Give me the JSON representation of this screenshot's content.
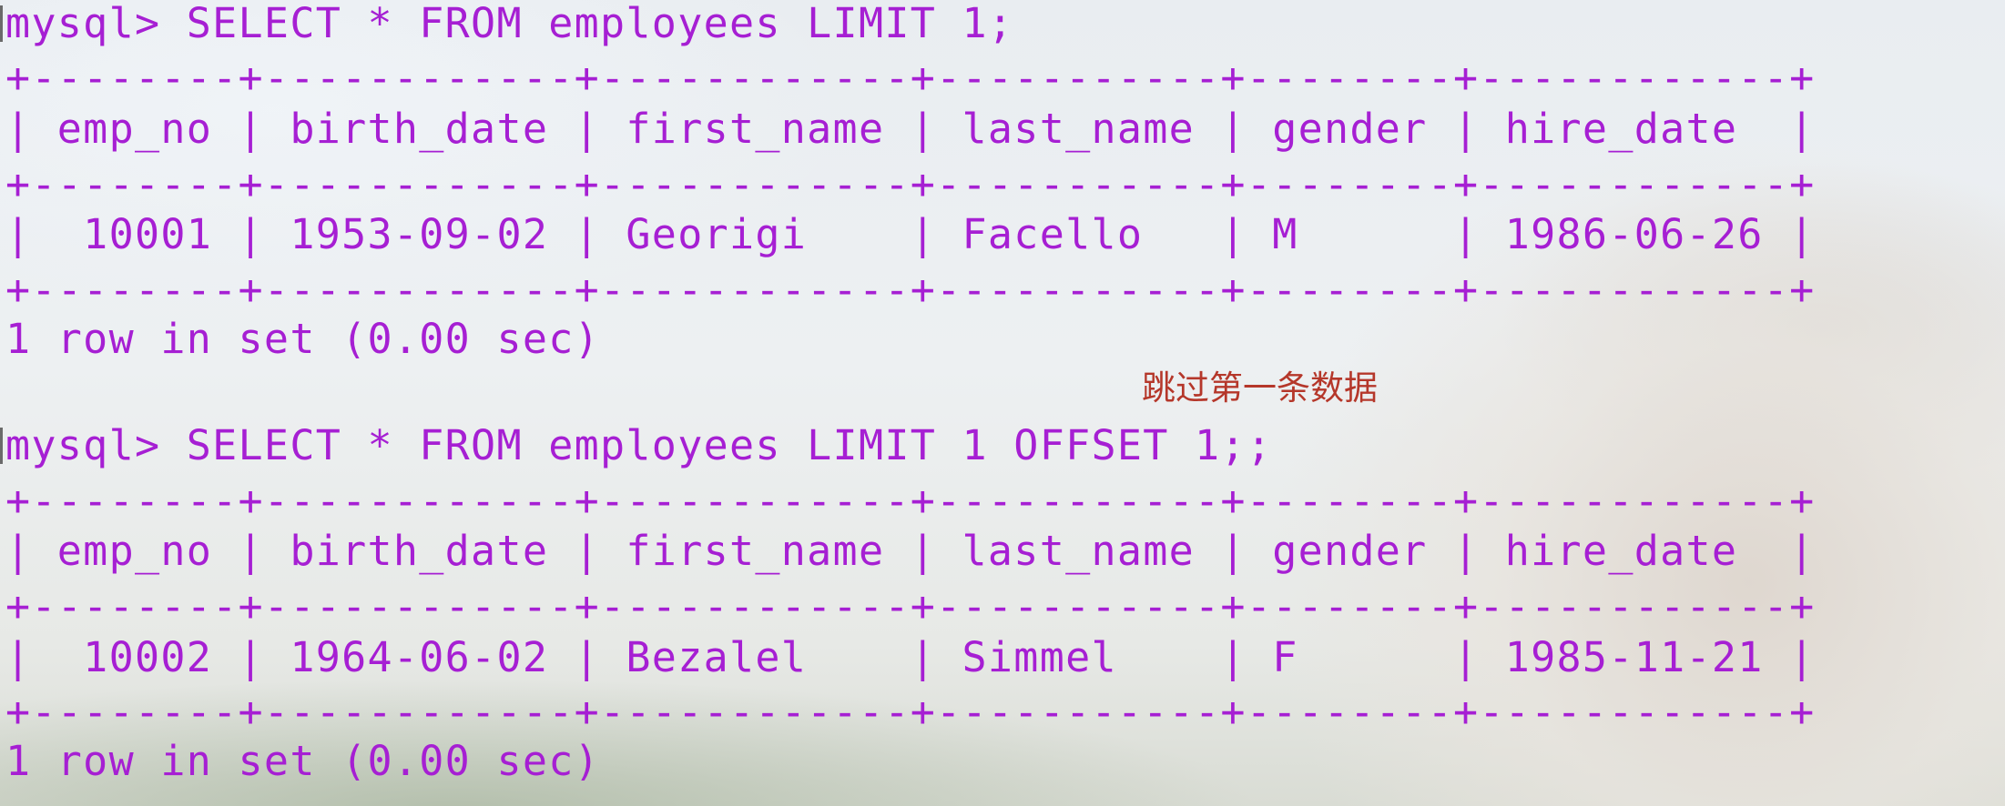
{
  "terminal": {
    "query1": {
      "command": "mysql> SELECT * FROM employees LIMIT 1;",
      "border_top": "+--------+------------+------------+-----------+--------+------------+",
      "header": "| emp_no | birth_date | first_name | last_name | gender | hire_date  |",
      "border_mid": "+--------+------------+------------+-----------+--------+------------+",
      "row": "|  10001 | 1953-09-02 | Georigi    | Facello   | M      | 1986-06-26 |",
      "border_bottom": "+--------+------------+------------+-----------+--------+------------+",
      "result": "1 row in set (0.00 sec)",
      "columns": [
        "emp_no",
        "birth_date",
        "first_name",
        "last_name",
        "gender",
        "hire_date"
      ],
      "rows": [
        [
          "10001",
          "1953-09-02",
          "Georigi",
          "Facello",
          "M",
          "1986-06-26"
        ]
      ]
    },
    "annotation": "跳过第一条数据",
    "query2": {
      "command": "mysql> SELECT * FROM employees LIMIT 1 OFFSET 1;;",
      "border_top": "+--------+------------+------------+-----------+--------+------------+",
      "header": "| emp_no | birth_date | first_name | last_name | gender | hire_date  |",
      "border_mid": "+--------+------------+------------+-----------+--------+------------+",
      "row": "|  10002 | 1964-06-02 | Bezalel    | Simmel    | F      | 1985-11-21 |",
      "border_bottom": "+--------+------------+------------+-----------+--------+------------+",
      "result": "1 row in set (0.00 sec)",
      "columns": [
        "emp_no",
        "birth_date",
        "first_name",
        "last_name",
        "gender",
        "hire_date"
      ],
      "rows": [
        [
          "10002",
          "1964-06-02",
          "Bezalel",
          "Simmel",
          "F",
          "1985-11-21"
        ]
      ]
    },
    "colors": {
      "text": "#a61fd3",
      "annotation": "#b5372a"
    }
  }
}
